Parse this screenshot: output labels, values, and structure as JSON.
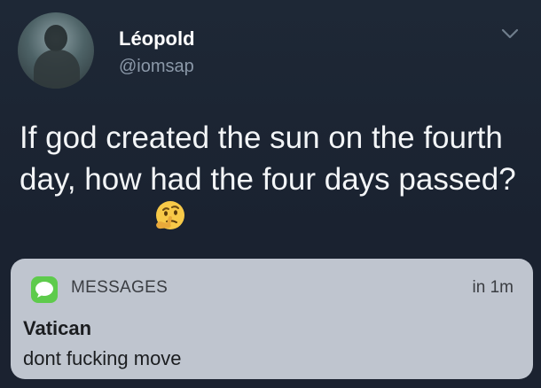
{
  "tweet": {
    "display_name": "Léopold",
    "handle": "@iomsap",
    "text": "If god created the sun on the fourth day, how had the four days passed?",
    "avatar_icon": "profile-photo",
    "menu_icon": "chevron-down-icon",
    "emoji_icon": "thinking-face-icon"
  },
  "notification": {
    "app_name": "MESSAGES",
    "time": "in 1m",
    "sender": "Vatican",
    "message": "dont fucking move",
    "app_icon": "speech-bubble-icon",
    "app_icon_color": "#5ecb4c"
  },
  "colors": {
    "background": "#1c2430",
    "notification_background": "#bfc5cf",
    "text_primary": "#ffffff",
    "text_secondary": "#8b98a8"
  }
}
